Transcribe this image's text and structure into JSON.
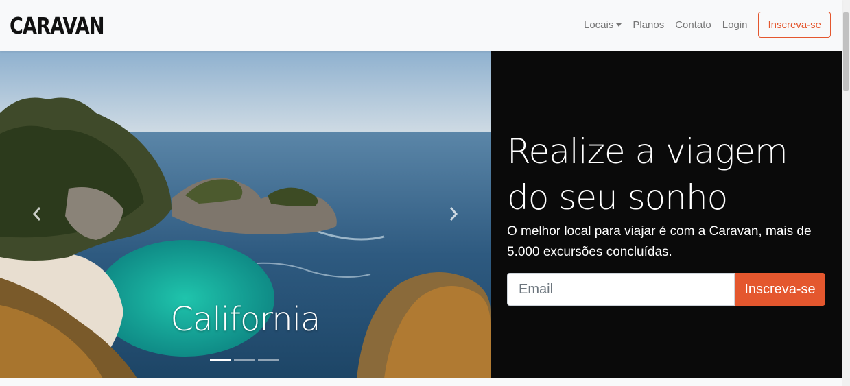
{
  "navbar": {
    "brand": "CARAVAN",
    "links": [
      {
        "label": "Locais",
        "dropdown": true
      },
      {
        "label": "Planos"
      },
      {
        "label": "Contato"
      },
      {
        "label": "Login"
      }
    ],
    "cta_label": "Inscreva-se"
  },
  "carousel": {
    "caption": "California",
    "slide_count": 3,
    "active_slide": 1,
    "prev_icon": "chevron-left-icon",
    "next_icon": "chevron-right-icon"
  },
  "hero": {
    "headline_line1": "Realize a viagem",
    "headline_line2": "do seu sonho",
    "subtext": "O melhor local para viajar é com a Caravan, mais de 5.000 excursões concluídas.",
    "email_placeholder": "Email",
    "email_value": "",
    "submit_label": "Inscreva-se"
  },
  "colors": {
    "accent": "#e4572e",
    "navbar_bg": "#f8f9fa",
    "panel_bg": "#0a0a0a",
    "nav_text": "#777777"
  }
}
